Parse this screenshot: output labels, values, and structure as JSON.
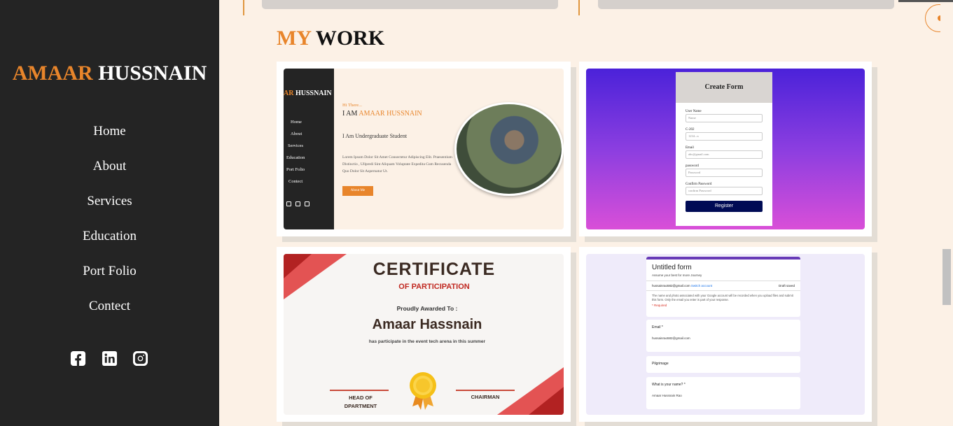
{
  "brand": {
    "first": "AMAAR",
    "last": "HUSSNAIN"
  },
  "nav": [
    "Home",
    "About",
    "Services",
    "Education",
    "Port Folio",
    "Contect"
  ],
  "social": [
    "facebook-icon",
    "linkedin-icon",
    "instagram-icon"
  ],
  "section": {
    "title_highlight": "MY",
    "title_rest": "WORK"
  },
  "colors": {
    "accent": "#e8852b",
    "sidebar": "#242424",
    "background": "#fcf1e6"
  },
  "work": {
    "portfolio": {
      "logo_first": "AR",
      "logo_last": "HUSSNAIN",
      "nav": [
        "Home",
        "About",
        "Services",
        "Education",
        "Port Folio",
        "Contect"
      ],
      "hi": "Hi There...",
      "iam": "I AM",
      "name": "AMAAR HUSSNAIN",
      "sub": "I Am Undergraduate Student",
      "lorem": "Lorem Ipsum Dolor Sit Amet Consectetur Adipiscing Elit. Praesentium Distinctio , Ullpredi Sint Aliquam Voluptate Expedita Cum Recusenda Quo Dolor Sit Aspernatur Ut.",
      "button": "About Me"
    },
    "create_form": {
      "title": "Create Form",
      "fields": [
        {
          "label": "User Name",
          "placeholder": "Name"
        },
        {
          "label": "C-202",
          "placeholder": "1234...n"
        },
        {
          "label": "Email",
          "placeholder": "abc@gmail.com"
        },
        {
          "label": "password",
          "placeholder": "Password"
        },
        {
          "label": "Confirm Password",
          "placeholder": "confirm Password"
        }
      ],
      "button": "Register"
    },
    "certificate": {
      "title": "CERTIFICATE",
      "subtitle": "OF PARTICIPATION",
      "awarded": "Proudly Awarded To :",
      "name": "Amaar Hassnain",
      "desc": "has participate in the event tech arena in this summer",
      "sig1_a": "HEAD OF",
      "sig1_b": "DPARTMENT",
      "sig2": "CHAIRMAN"
    },
    "google_form": {
      "title": "Untitled form",
      "desc": "Assume your best for more Journey",
      "email": "hussainrao582@gmail.com",
      "switch": "Switch account",
      "saved": "Draft saved",
      "note": "The name and photo associated with your Google account will be recorded when you upload files and submit this form. Only the email you enter is part of your response.",
      "required": "* Required",
      "q1": "Email *",
      "a1": "hussainrao582@gmail.com",
      "q2": "Pilgrimage",
      "q3": "What is your name? *",
      "a3": "Amaar Hussnain Rao"
    }
  }
}
